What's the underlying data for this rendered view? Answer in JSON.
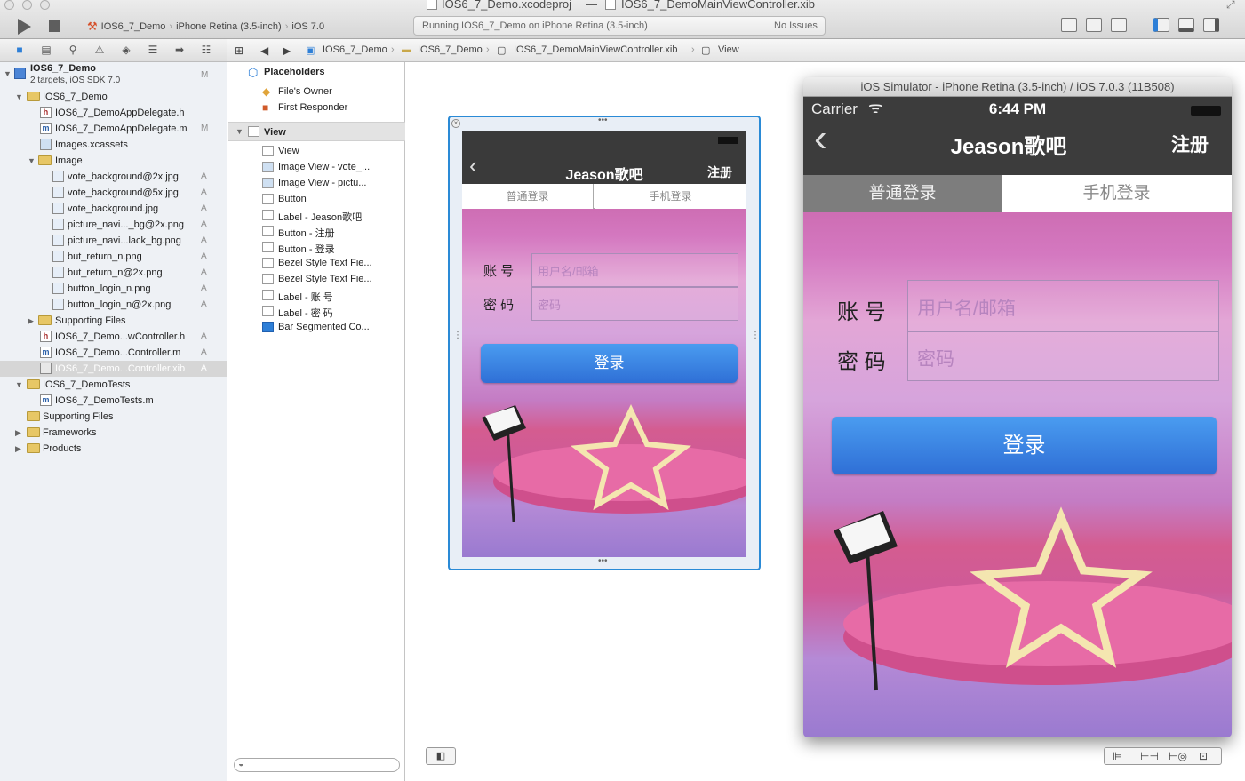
{
  "window": {
    "title_project": "IOS6_7_Demo.xcodeproj",
    "title_separator": "—",
    "title_file": "IOS6_7_DemoMainViewController.xib"
  },
  "toolbar": {
    "scheme_target": "IOS6_7_Demo",
    "scheme_device": "iPhone Retina (3.5-inch)",
    "scheme_os": "iOS 7.0",
    "status_text": "Running IOS6_7_Demo on iPhone Retina (3.5-inch)",
    "issues_text": "No Issues"
  },
  "navigator": {
    "items": [
      {
        "label": "IOS6_7_Demo",
        "sub": "2 targets, iOS SDK 7.0",
        "badge": "M"
      },
      {
        "label": "IOS6_7_Demo",
        "badge": ""
      },
      {
        "label": "IOS6_7_DemoAppDelegate.h",
        "badge": ""
      },
      {
        "label": "IOS6_7_DemoAppDelegate.m",
        "badge": "M"
      },
      {
        "label": "Images.xcassets",
        "badge": ""
      },
      {
        "label": "Image",
        "badge": ""
      },
      {
        "label": "vote_background@2x.jpg",
        "badge": "A"
      },
      {
        "label": "vote_background@5x.jpg",
        "badge": "A"
      },
      {
        "label": "vote_background.jpg",
        "badge": "A"
      },
      {
        "label": "picture_navi..._bg@2x.png",
        "badge": "A"
      },
      {
        "label": "picture_navi...lack_bg.png",
        "badge": "A"
      },
      {
        "label": "but_return_n.png",
        "badge": "A"
      },
      {
        "label": "but_return_n@2x.png",
        "badge": "A"
      },
      {
        "label": "button_login_n.png",
        "badge": "A"
      },
      {
        "label": "button_login_n@2x.png",
        "badge": "A"
      },
      {
        "label": "Supporting Files",
        "badge": ""
      },
      {
        "label": "IOS6_7_Demo...wController.h",
        "badge": "A"
      },
      {
        "label": "IOS6_7_Demo...Controller.m",
        "badge": "A"
      },
      {
        "label": "IOS6_7_Demo...Controller.xib",
        "badge": "A"
      },
      {
        "label": "IOS6_7_DemoTests",
        "badge": ""
      },
      {
        "label": "IOS6_7_DemoTests.m",
        "badge": ""
      },
      {
        "label": "Supporting Files",
        "badge": ""
      },
      {
        "label": "Frameworks",
        "badge": ""
      },
      {
        "label": "Products",
        "badge": ""
      }
    ]
  },
  "jumpbar": {
    "crumbs": [
      "IOS6_7_Demo",
      "IOS6_7_Demo",
      "IOS6_7_DemoMainViewController.xib",
      "View"
    ]
  },
  "outline": {
    "placeholders_header": "Placeholders",
    "files_owner": "File's Owner",
    "first_responder": "First Responder",
    "view_header": "View",
    "items": [
      "View",
      "Image View - vote_...",
      "Image View - pictu...",
      "Button",
      "Label - Jeason歌吧",
      "Button - 注册",
      "Button - 登录",
      "Bezel Style Text Fie...",
      "Bezel Style Text Fie...",
      "Label - 账 号",
      "Label - 密 码",
      "Bar Segmented Co..."
    ]
  },
  "app": {
    "nav_title": "Jeason歌吧",
    "right_button": "注册",
    "segments": [
      "普通登录",
      "手机登录"
    ],
    "selected_segment": 0,
    "account_label": "账 号",
    "password_label": "密 码",
    "account_placeholder": "用户名/邮箱",
    "password_placeholder": "密码",
    "login_button": "登录"
  },
  "simulator": {
    "title": "iOS Simulator - iPhone Retina (3.5-inch) / iOS 7.0.3 (11B508)",
    "carrier": "Carrier",
    "time": "6:44 PM"
  },
  "colors": {
    "selection": "#d6d6d6",
    "nav_bar": "#3c3c3c",
    "login_blue": "#2f7ae0",
    "xib_selection": "#2a8ad6"
  }
}
